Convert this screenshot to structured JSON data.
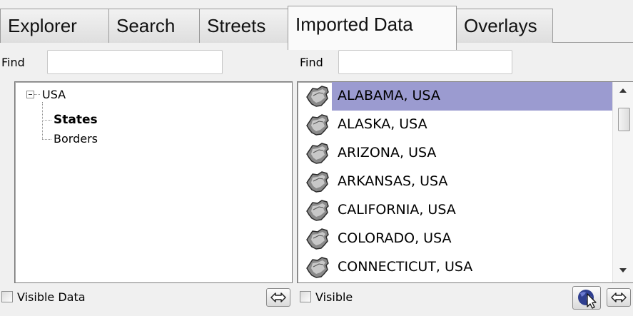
{
  "tabs": [
    {
      "label": "Explorer",
      "active": false
    },
    {
      "label": "Search",
      "active": false
    },
    {
      "label": "Streets",
      "active": false
    },
    {
      "label": "Imported Data",
      "active": true
    },
    {
      "label": "Overlays",
      "active": false
    }
  ],
  "left": {
    "find_label": "Find",
    "find_value": "",
    "tree": {
      "root": "USA",
      "children": [
        "States",
        "Borders"
      ],
      "selected": "States"
    },
    "visible_label": "Visible Data",
    "visible_checked": false
  },
  "right": {
    "find_label": "Find",
    "find_value": "",
    "items": [
      "ALABAMA, USA",
      "ALASKA, USA",
      "ARIZONA, USA",
      "ARKANSAS, USA",
      "CALIFORNIA, USA",
      "COLORADO, USA",
      "CONNECTICUT, USA"
    ],
    "selected_index": 0,
    "item_icon": "state-shape-icon",
    "visible_label": "Visible",
    "visible_checked": false
  },
  "colors": {
    "selection": "#9b9bd0",
    "background": "#f0f0f0"
  }
}
